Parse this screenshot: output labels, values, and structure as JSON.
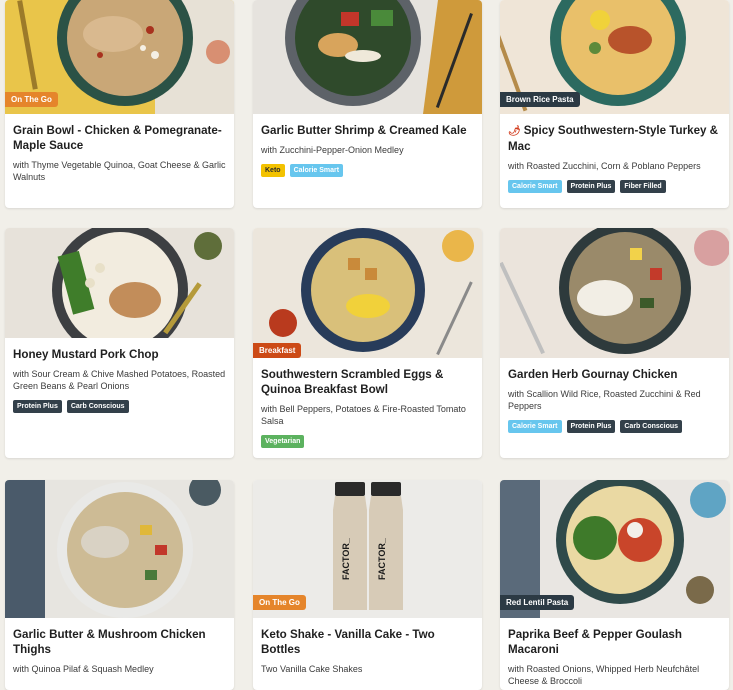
{
  "colors": {
    "on_the_go_badge": "#e5852b",
    "breakfast_badge": "#cc4a16",
    "pasta_badge": "#2c3a44",
    "tag_keto": "#f3c200",
    "tag_calorie_smart": "#67c6ee",
    "tag_dark": "#33404a",
    "tag_vegetarian": "#5cb25f",
    "page_bg": "#f1efe9"
  },
  "cards": [
    {
      "badge": "On The Go",
      "title": "Grain Bowl - Chicken & Pomegranate-Maple Sauce",
      "subtitle": "with Thyme Vegetable Quinoa, Goat Cheese & Garlic Walnuts",
      "tags": []
    },
    {
      "badge": "",
      "title": "Garlic Butter Shrimp & Creamed Kale",
      "subtitle": "with Zucchini-Pepper-Onion Medley",
      "tags": [
        "Keto",
        "Calorie Smart"
      ]
    },
    {
      "badge": "Brown Rice Pasta",
      "title": "Spicy Southwestern-Style Turkey & Mac",
      "subtitle": "with Roasted Zucchini, Corn & Poblano Peppers",
      "tags": [
        "Calorie Smart",
        "Protein Plus",
        "Fiber Filled"
      ],
      "icon": "chili-pepper-icon"
    },
    {
      "badge": "",
      "title": "Honey Mustard Pork Chop",
      "subtitle": "with Sour Cream & Chive Mashed Potatoes, Roasted Green Beans & Pearl Onions",
      "tags": [
        "Protein Plus",
        "Carb Conscious"
      ]
    },
    {
      "badge": "Breakfast",
      "title": "Southwestern Scrambled Eggs & Quinoa Breakfast Bowl",
      "subtitle": "with Bell Peppers, Potatoes & Fire-Roasted Tomato Salsa",
      "tags": [
        "Vegetarian"
      ]
    },
    {
      "badge": "",
      "title": "Garden Herb Gournay Chicken",
      "subtitle": "with Scallion Wild Rice, Roasted Zucchini & Red Peppers",
      "tags": [
        "Calorie Smart",
        "Protein Plus",
        "Carb Conscious"
      ]
    },
    {
      "badge": "",
      "title": "Garlic Butter & Mushroom Chicken Thighs",
      "subtitle": "with Quinoa Pilaf & Squash Medley",
      "tags": []
    },
    {
      "badge": "On The Go",
      "title": "Keto Shake - Vanilla Cake - Two Bottles",
      "subtitle": "Two Vanilla Cake Shakes",
      "tags": []
    },
    {
      "badge": "Red Lentil Pasta",
      "title": "Paprika Beef & Pepper Goulash Macaroni",
      "subtitle": "with Roasted Onions, Whipped Herb Neufchâtel Cheese & Broccoli",
      "tags": []
    }
  ],
  "bottle_logo": "FACTOR_"
}
